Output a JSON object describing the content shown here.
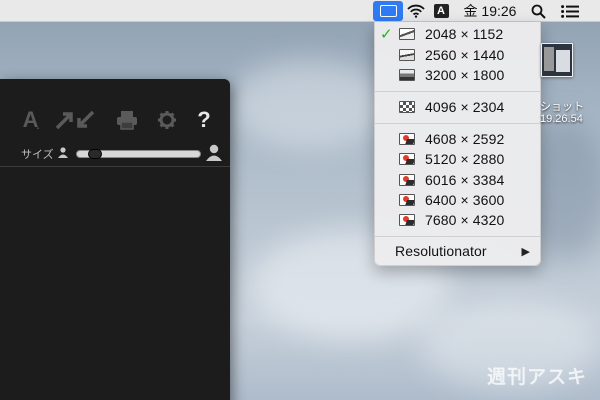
{
  "menubar": {
    "clock": "金 19:26",
    "input_method": "A",
    "icons": [
      "display-icon",
      "wifi-icon",
      "input-source-icon",
      "spotlight-search-icon",
      "notification-center-icon"
    ]
  },
  "resolution_menu": {
    "selected": "2048 × 1152",
    "items": [
      {
        "label": "2048 × 1152",
        "icon": "thumb-icon-1",
        "checked": true
      },
      {
        "label": "2560 × 1440",
        "icon": "thumb-icon-2",
        "checked": false
      },
      {
        "label": "3200 × 1800",
        "icon": "thumb-icon-3",
        "checked": false
      },
      {
        "label": "4096 × 2304",
        "icon": "checker-thumb-icon",
        "checked": false
      },
      {
        "label": "4608 × 2592",
        "icon": "pixel-thumb-icon",
        "checked": false
      },
      {
        "label": "5120 × 2880",
        "icon": "pixel-thumb-icon",
        "checked": false
      },
      {
        "label": "6016 × 3384",
        "icon": "pixel-thumb-icon",
        "checked": false
      },
      {
        "label": "6400 × 3600",
        "icon": "pixel-thumb-icon",
        "checked": false
      },
      {
        "label": "7680 × 4320",
        "icon": "pixel-thumb-icon",
        "checked": false
      }
    ],
    "footer": {
      "label": "Resolutionator",
      "arrow": "▶"
    },
    "check_glyph": "✓"
  },
  "app_window": {
    "text_tool_glyph": "A",
    "help_glyph": "?",
    "size_label": "サイズ",
    "slider_value": 0.1
  },
  "desktop_file": {
    "name": "ショット",
    "time": "19.26.54"
  },
  "watermark": "週刊アスキー",
  "colors": {
    "menu_selected_bg": "#2f7bf4",
    "check_green": "#1fb41f",
    "app_bg": "#1c1c1c"
  }
}
